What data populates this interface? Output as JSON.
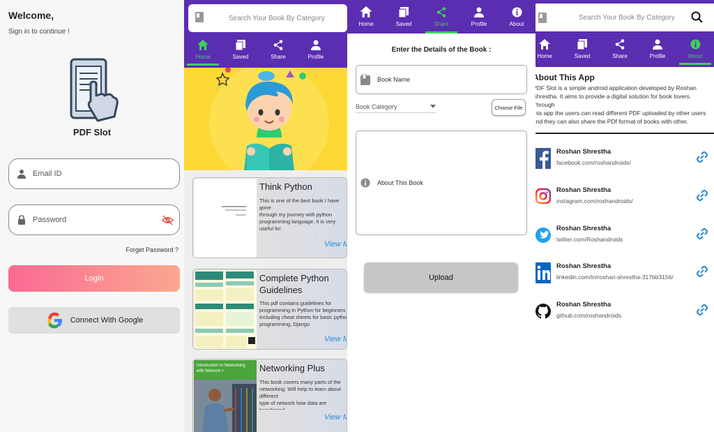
{
  "login": {
    "welcome": "Welcome,",
    "signin": "Sign in to continue !",
    "app_name": "PDF Slot",
    "email_placeholder": "Email ID",
    "password_placeholder": "Password",
    "forgot": "Forget Password ?",
    "login_label": "Login",
    "google_label": "Connect With Google"
  },
  "home": {
    "search_placeholder": "Search Your Book By Category",
    "tabs": [
      {
        "label": "Home",
        "icon": "home-icon",
        "active": true
      },
      {
        "label": "Saved",
        "icon": "saved-icon"
      },
      {
        "label": "Share",
        "icon": "share-icon"
      },
      {
        "label": "Profile",
        "icon": "profile-icon"
      }
    ],
    "books": [
      {
        "title": "Think Python",
        "desc": "This is one of the best book I have gone\nthrough my journey with python\nprogramming language. It is very useful for\nthe beginners so I thought to share it with\nguys. #Happy_Reading 🙂",
        "more": "View More"
      },
      {
        "title": "Complete Python Guidelines",
        "desc": "This pdf contains guidelines for\nprogramming in Python for beginners\nincluding cheat sheets for basic python\nprogramming, Django",
        "more": "View More"
      },
      {
        "title": "Networking Plus",
        "desc": "This book covers many parts of the\nnetworking. Will help to learn about different\ntype of network how data are transferred\nand many more. Enjoy 😊",
        "more": "View More",
        "cover_title": "Introduction to Networking with Network +"
      }
    ]
  },
  "upload": {
    "tabs": [
      {
        "label": "Home",
        "icon": "home-icon"
      },
      {
        "label": "Saved",
        "icon": "saved-icon"
      },
      {
        "label": "Share",
        "icon": "share-icon",
        "active": true
      },
      {
        "label": "Profile",
        "icon": "profile-icon"
      },
      {
        "label": "About",
        "icon": "info-icon"
      }
    ],
    "heading": "Enter the Details of the Book :",
    "book_name": "Book Name",
    "category": "Book Category",
    "choose_file": "Choose File",
    "about_book": "About This Book",
    "upload_label": "Upload"
  },
  "about": {
    "search_placeholder": "Search Your Book By Category",
    "tabs": [
      {
        "label": "Home",
        "icon": "home-icon"
      },
      {
        "label": "Saved",
        "icon": "saved-icon"
      },
      {
        "label": "Share",
        "icon": "share-icon"
      },
      {
        "label": "Profile",
        "icon": "profile-icon"
      },
      {
        "label": "About",
        "icon": "info-icon",
        "active": true
      }
    ],
    "title": "About This App",
    "text": "PDF Slot is a simple android application developed by Roshan\nShrestha. It aims to provide a digital solution for book lovers. Through\nthis app the users can read different PDF uploaded by other users\nand they can also share the PDf format of books with other.",
    "socials": [
      {
        "name": "Roshan Shrestha",
        "link": "facebook.com/roshandroids/",
        "icon": "facebook-icon"
      },
      {
        "name": "Roshan Shrestha",
        "link": "instagram.com/roshandroids/",
        "icon": "instagram-icon"
      },
      {
        "name": "Roshan Shrestha",
        "link": "twitter.com/Roshandroids",
        "icon": "twitter-icon"
      },
      {
        "name": "Roshan Shrestha",
        "link": "linkedin.com/in/roshan-shrestha-317bb3156/",
        "icon": "linkedin-icon"
      },
      {
        "name": "Roshan Shrestha",
        "link": "github.com/roshandroids",
        "icon": "github-icon"
      }
    ]
  },
  "colors": {
    "purple": "#5b2db1",
    "active_tab": "#3fcf5d",
    "login_gradient_start": "#fb6a94",
    "login_gradient_end": "#f9a98e",
    "link_blue": "#2a8bd6"
  }
}
